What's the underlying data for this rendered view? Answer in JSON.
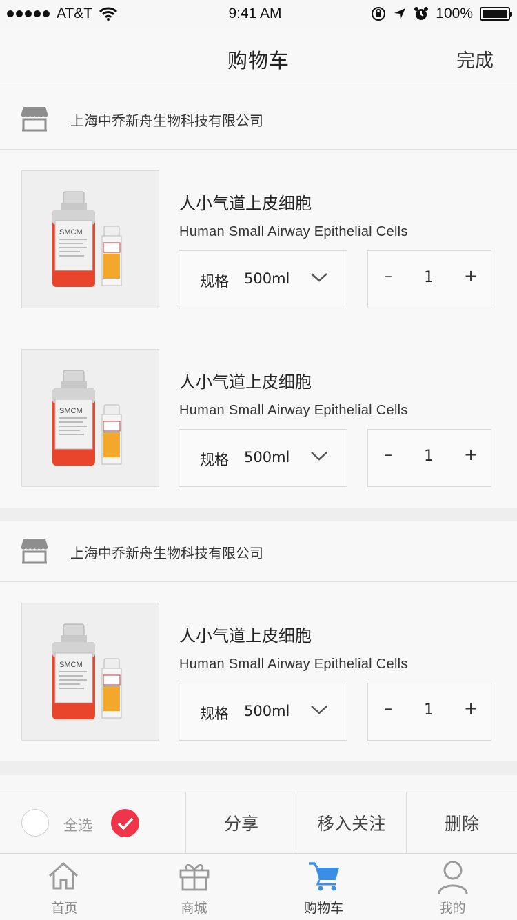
{
  "status_bar": {
    "carrier": "AT&T",
    "time": "9:41 AM",
    "battery": "100%",
    "icons": [
      "signal-dots-icon",
      "wifi-icon",
      "orientation-lock-icon",
      "location-arrow-icon",
      "alarm-icon",
      "battery-icon"
    ]
  },
  "navbar": {
    "title": "购物车",
    "done_label": "完成"
  },
  "stores": [
    {
      "name": "上海中乔新舟生物科技有限公司",
      "items": [
        {
          "title": "人小气道上皮细胞",
          "subtitle": "Human Small Airway Epithelial Cells",
          "spec_label": "规格",
          "spec_value": "500ml",
          "quantity": "1",
          "product_label": "SMCM"
        },
        {
          "title": "人小气道上皮细胞",
          "subtitle": "Human Small Airway Epithelial Cells",
          "spec_label": "规格",
          "spec_value": "500ml",
          "quantity": "1",
          "product_label": "SMCM"
        }
      ]
    },
    {
      "name": "上海中乔新舟生物科技有限公司",
      "items": [
        {
          "title": "人小气道上皮细胞",
          "subtitle": "Human Small Airway Epithelial Cells",
          "spec_label": "规格",
          "spec_value": "500ml",
          "quantity": "1",
          "product_label": "SMCM"
        }
      ]
    }
  ],
  "qty_controls": {
    "minus": "–",
    "plus": "+"
  },
  "action_bar": {
    "select_all": "全选",
    "share": "分享",
    "move_to_favorites": "移入关注",
    "delete": "删除"
  },
  "tabbar": {
    "items": [
      {
        "label": "首页",
        "icon": "home-icon"
      },
      {
        "label": "商城",
        "icon": "gift-icon"
      },
      {
        "label": "购物车",
        "icon": "cart-icon",
        "active": true
      },
      {
        "label": "我的",
        "icon": "user-icon"
      }
    ]
  },
  "colors": {
    "accent_red": "#f0344a",
    "active_tab_blue": "#3a8ee6",
    "inactive_icon": "#9a9a9a"
  }
}
